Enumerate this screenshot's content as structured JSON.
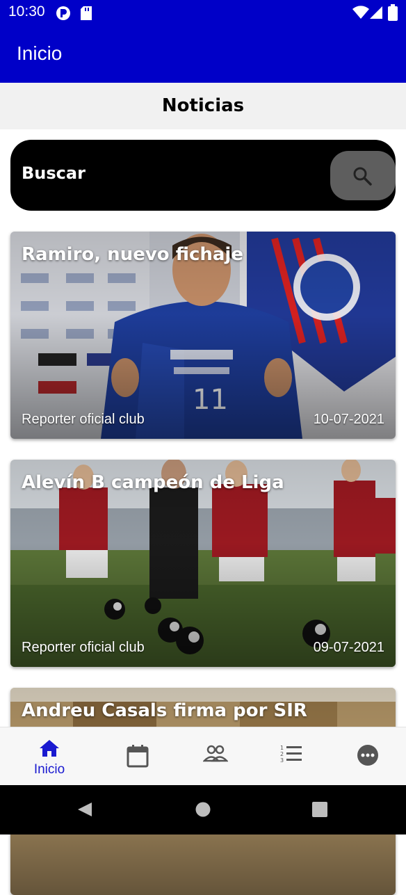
{
  "status_bar": {
    "time": "10:30"
  },
  "app_bar": {
    "title": "Inicio"
  },
  "section": {
    "title": "Noticias"
  },
  "search": {
    "label": "Buscar",
    "icon": "search-icon"
  },
  "news": [
    {
      "title": "Ramiro, nuevo fichaje",
      "author": "Reporter oficial club",
      "date": "10-07-2021"
    },
    {
      "title": "Alevín B campeón de Liga",
      "author": "Reporter oficial club",
      "date": "09-07-2021"
    },
    {
      "title": "Andreu Casals firma por SIR"
    }
  ],
  "bottom_nav": [
    {
      "label": "Inicio",
      "icon": "home-icon",
      "active": true
    },
    {
      "label": "",
      "icon": "calendar-icon"
    },
    {
      "label": "",
      "icon": "people-icon"
    },
    {
      "label": "",
      "icon": "list-icon"
    },
    {
      "label": "",
      "icon": "more-icon"
    }
  ],
  "colors": {
    "primary": "#0000c8",
    "active_nav": "#1a1ad0",
    "nav_inactive": "#555555"
  }
}
